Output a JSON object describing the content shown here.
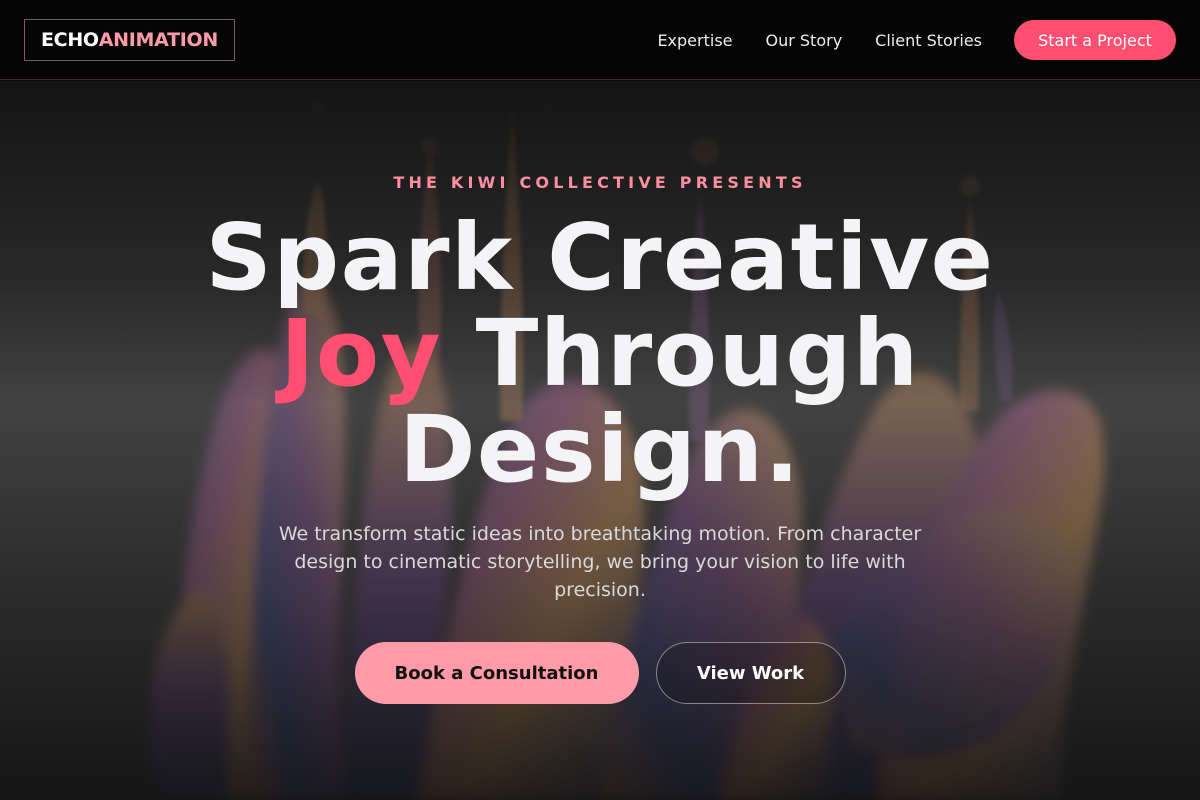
{
  "brand": {
    "logo_part1": "ECHO",
    "logo_part2": "ANIMATION"
  },
  "nav": {
    "links": [
      "Expertise",
      "Our Story",
      "Client Stories"
    ],
    "cta_label": "Start a Project"
  },
  "hero": {
    "eyebrow": "THE KIWI COLLECTIVE PRESENTS",
    "headline_part1": "Spark Creative",
    "headline_accent": "Joy",
    "headline_part2": "Through Design.",
    "subtitle": "We transform static ideas into breathtaking motion. From character design to cinematic storytelling, we bring your vision to life with precision.",
    "primary_cta": "Book a Consultation",
    "secondary_cta": "View Work",
    "background_image": "iridescent-liquid-splash-sculpture"
  },
  "colors": {
    "accent": "#ff4f70",
    "accent_light": "#ff9aa8",
    "eyebrow": "#ff8fa0",
    "nav_background": "#050505"
  }
}
